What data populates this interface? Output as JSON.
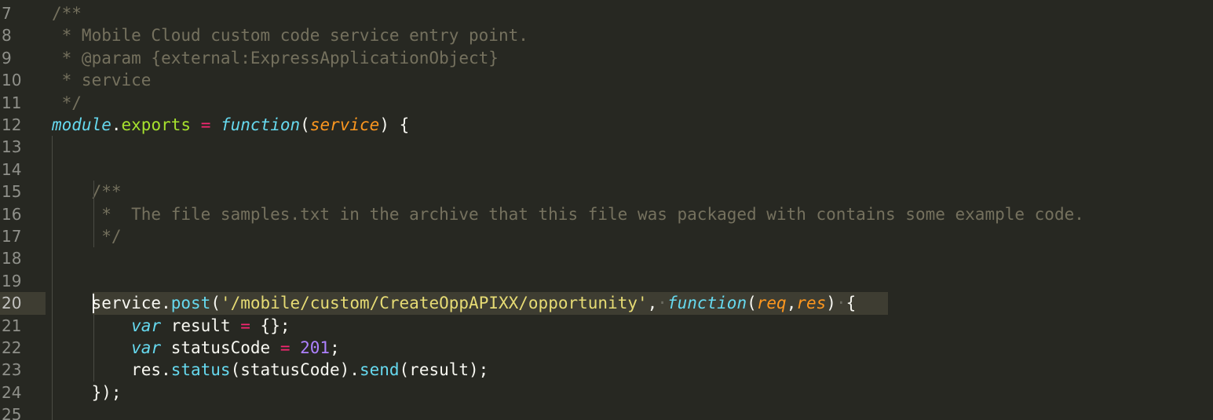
{
  "editor": {
    "theme_colors": {
      "background": "#272822",
      "comment": "#75715e",
      "keyword": "#66d9ef",
      "parameter": "#fd971f",
      "operator": "#f92672",
      "string": "#e6db74",
      "number": "#ae81ff",
      "property": "#a6e22e"
    },
    "active_line": "20",
    "line_numbers": [
      "7",
      "8",
      "9",
      "10",
      "11",
      "12",
      "13",
      "14",
      "15",
      "16",
      "17",
      "18",
      "19",
      "20",
      "21",
      "22",
      "23",
      "24",
      "25"
    ],
    "lines": [
      {
        "num": "7",
        "tokens": [
          {
            "t": "/**",
            "c": "comment"
          }
        ]
      },
      {
        "num": "8",
        "tokens": [
          {
            "t": " * Mobile Cloud custom code service entry point.",
            "c": "comment"
          }
        ]
      },
      {
        "num": "9",
        "tokens": [
          {
            "t": " * @param {external:ExpressApplicationObject}",
            "c": "comment"
          }
        ]
      },
      {
        "num": "10",
        "tokens": [
          {
            "t": " * service",
            "c": "comment"
          }
        ]
      },
      {
        "num": "11",
        "tokens": [
          {
            "t": " */",
            "c": "comment"
          }
        ]
      },
      {
        "num": "12",
        "tokens": [
          {
            "t": "module",
            "c": "obj"
          },
          {
            "t": ".",
            "c": "plain"
          },
          {
            "t": "exports",
            "c": "prop"
          },
          {
            "t": " ",
            "c": "plain"
          },
          {
            "t": "=",
            "c": "op"
          },
          {
            "t": " ",
            "c": "plain"
          },
          {
            "t": "function",
            "c": "key"
          },
          {
            "t": "(",
            "c": "plain"
          },
          {
            "t": "service",
            "c": "param"
          },
          {
            "t": ") {",
            "c": "plain"
          }
        ]
      },
      {
        "num": "13",
        "tokens": []
      },
      {
        "num": "14",
        "tokens": []
      },
      {
        "num": "15",
        "tokens": [
          {
            "t": "    /**",
            "c": "comment"
          }
        ]
      },
      {
        "num": "16",
        "tokens": [
          {
            "t": "     *  The file samples.txt in the archive that this file was packaged with contains some example code.",
            "c": "comment"
          }
        ]
      },
      {
        "num": "17",
        "tokens": [
          {
            "t": "     */",
            "c": "comment"
          }
        ]
      },
      {
        "num": "18",
        "tokens": []
      },
      {
        "num": "19",
        "tokens": []
      },
      {
        "num": "20",
        "tokens": [
          {
            "t": "    service",
            "c": "plain"
          },
          {
            "t": ".",
            "c": "plain"
          },
          {
            "t": "post",
            "c": "method"
          },
          {
            "t": "(",
            "c": "plain"
          },
          {
            "t": "'/mobile/custom/CreateOppAPIXX/opportunity'",
            "c": "str"
          },
          {
            "t": ",",
            "c": "plain"
          },
          {
            "t": "·",
            "c": "ws"
          },
          {
            "t": "function",
            "c": "key"
          },
          {
            "t": "(",
            "c": "plain"
          },
          {
            "t": "req",
            "c": "param"
          },
          {
            "t": ",",
            "c": "plain"
          },
          {
            "t": "res",
            "c": "param"
          },
          {
            "t": ")",
            "c": "plain"
          },
          {
            "t": "·",
            "c": "ws"
          },
          {
            "t": "{",
            "c": "plain"
          }
        ]
      },
      {
        "num": "21",
        "tokens": [
          {
            "t": "        ",
            "c": "plain"
          },
          {
            "t": "var",
            "c": "key"
          },
          {
            "t": " result ",
            "c": "plain"
          },
          {
            "t": "=",
            "c": "op"
          },
          {
            "t": " {};",
            "c": "plain"
          }
        ]
      },
      {
        "num": "22",
        "tokens": [
          {
            "t": "        ",
            "c": "plain"
          },
          {
            "t": "var",
            "c": "key"
          },
          {
            "t": " statusCode ",
            "c": "plain"
          },
          {
            "t": "=",
            "c": "op"
          },
          {
            "t": " ",
            "c": "plain"
          },
          {
            "t": "201",
            "c": "num"
          },
          {
            "t": ";",
            "c": "plain"
          }
        ]
      },
      {
        "num": "23",
        "tokens": [
          {
            "t": "        res.",
            "c": "plain"
          },
          {
            "t": "status",
            "c": "method"
          },
          {
            "t": "(statusCode).",
            "c": "plain"
          },
          {
            "t": "send",
            "c": "method"
          },
          {
            "t": "(result);",
            "c": "plain"
          }
        ]
      },
      {
        "num": "24",
        "tokens": [
          {
            "t": "    });",
            "c": "plain"
          }
        ]
      },
      {
        "num": "25",
        "tokens": []
      }
    ]
  }
}
